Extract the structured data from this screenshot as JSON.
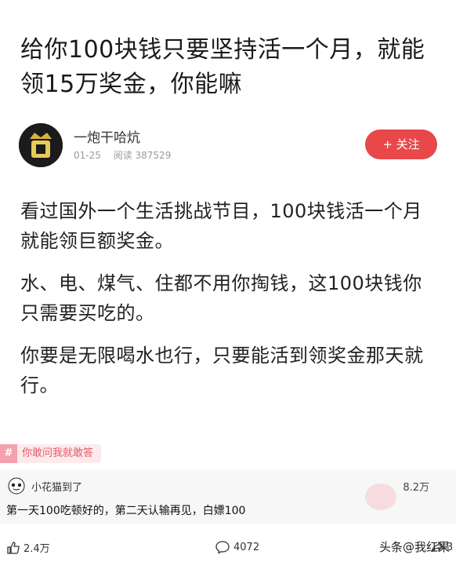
{
  "article": {
    "title": "给你100块钱只要坚持活一个月，就能领15万奖金，你能嘛"
  },
  "author": {
    "name": "一炮干哈炕",
    "date": "01-25",
    "views": "阅读 387529",
    "follow_label": "+ 关注"
  },
  "body": {
    "paragraphs": [
      "看过国外一个生活挑战节目，100块钱活一个月就能领巨额奖金。",
      "水、电、煤气、住都不用你掏钱，这100块钱你只需要买吃的。",
      "你要是无限喝水也行，只要能活到领奖金那天就行。"
    ]
  },
  "tag": {
    "label": "你敢问我就敢答"
  },
  "comment": {
    "user": "小花猫到了",
    "likes": "8.2万",
    "text": "第一天100吃顿好的，第二天认输再见，白嫖100"
  },
  "actions": {
    "likes": "2.4万",
    "comments": "4072",
    "share_partial": "3"
  },
  "watermark": "头条@我红果"
}
